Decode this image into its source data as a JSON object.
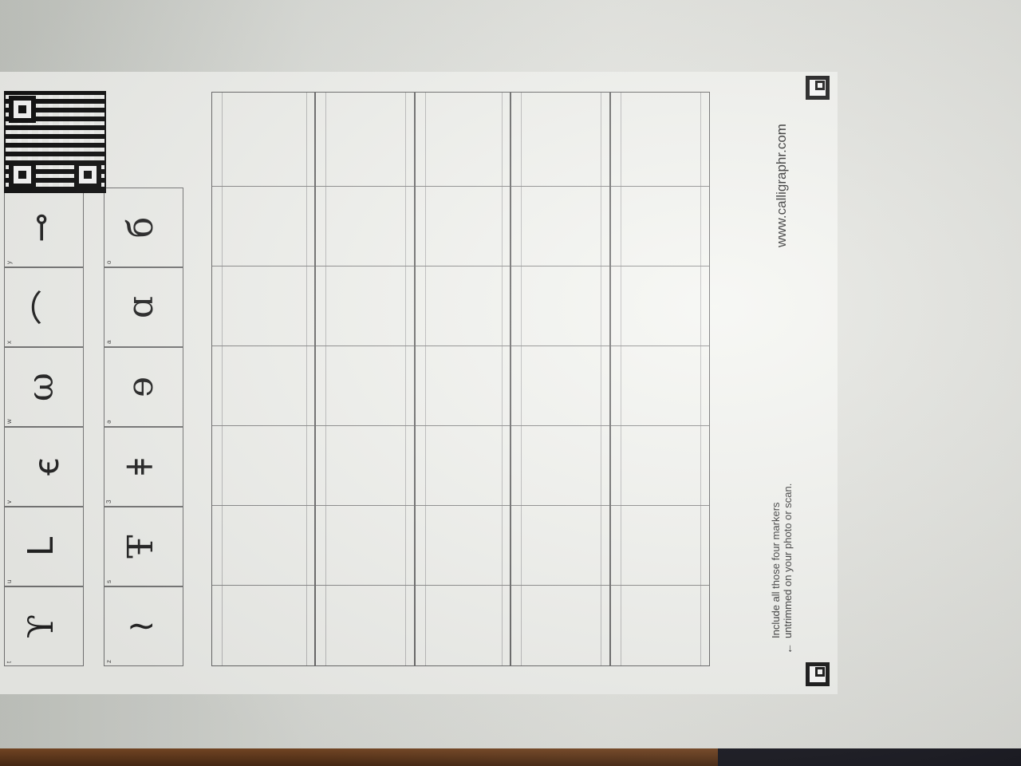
{
  "logo": "calligraphr",
  "footer": {
    "note_line1": "Include all those four markers",
    "note_line2": "untrimmed on your photo or scan.",
    "url": "www.calligraphr.com"
  },
  "row1": [
    {
      "label": "t",
      "glyph": "ϒ"
    },
    {
      "label": "u",
      "glyph": "ᒪ"
    },
    {
      "label": "v",
      "glyph": "ꞓ"
    },
    {
      "label": "w",
      "glyph": "ω"
    },
    {
      "label": "x",
      "glyph": "⌒"
    },
    {
      "label": "y",
      "glyph": "⊸"
    }
  ],
  "row2": [
    {
      "label": "z",
      "glyph": "≀"
    },
    {
      "label": "s",
      "glyph": "Ŧ"
    },
    {
      "label": "3",
      "glyph": "ǂ"
    },
    {
      "label": "ə",
      "glyph": "ɘ"
    },
    {
      "label": "a",
      "glyph": "ɑ"
    },
    {
      "label": "o",
      "glyph": "б"
    }
  ]
}
